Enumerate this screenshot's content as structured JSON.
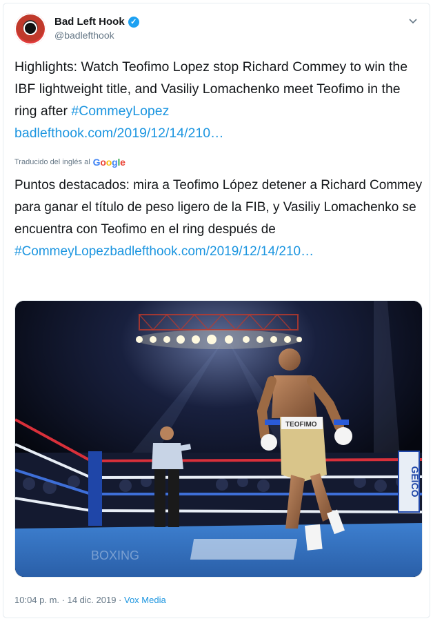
{
  "account": {
    "display_name": "Bad Left Hook",
    "handle": "@badlefthook",
    "verified_mark": "✓"
  },
  "tweet": {
    "text_part1": "Highlights: Watch Teofimo Lopez stop Richard Commey to win the IBF lightweight title, and Vasiliy Lomachenko meet Teofimo in the ring after ",
    "hashtag": "#CommeyLopez",
    "link": "badlefthook.com/2019/12/14/210…"
  },
  "translation": {
    "note": "Traducido del inglés al",
    "provider": "Google",
    "text_part1": "Puntos destacados: mira a Teofimo López detener a Richard Commey para ganar el título de peso ligero de la FIB, y Vasiliy Lomachenko se encuentra con Teofimo en el ring después de ",
    "hashtag_link": "#CommeyLopezbadlefthook.com/2019/12/14/210…"
  },
  "media": {
    "trunks_text": "TEOFIMO",
    "sponsor": "GEICO"
  },
  "footer": {
    "timestamp": "10:04 p. m. · 14 dic. 2019 · ",
    "source": "Vox Media"
  },
  "icons": {
    "more": "chevron-down-icon",
    "verified": "verified-badge-icon"
  },
  "colors": {
    "link": "#1b95e0",
    "verified": "#1da1f2"
  }
}
